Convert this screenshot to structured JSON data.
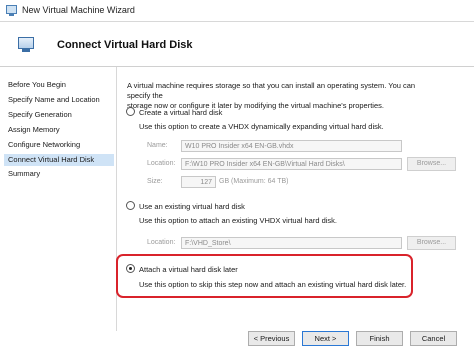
{
  "window": {
    "title": "New Virtual Machine Wizard"
  },
  "header": {
    "title": "Connect Virtual Hard Disk",
    "icon": "virtual-machine-icon"
  },
  "sidebar": {
    "items": [
      {
        "label": "Before You Begin",
        "active": false
      },
      {
        "label": "Specify Name and Location",
        "active": false
      },
      {
        "label": "Specify Generation",
        "active": false
      },
      {
        "label": "Assign Memory",
        "active": false
      },
      {
        "label": "Configure Networking",
        "active": false
      },
      {
        "label": "Connect Virtual Hard Disk",
        "active": true
      },
      {
        "label": "Summary",
        "active": false
      }
    ]
  },
  "main": {
    "intro_line1": "A virtual machine requires storage so that you can install an operating system. You can specify the",
    "intro_line2": "storage now or configure it later by modifying the virtual machine's properties.",
    "create": {
      "label": "Create a virtual hard disk",
      "description": "Use this option to create a VHDX dynamically expanding virtual hard disk.",
      "name_label": "Name:",
      "name_value": "W10 PRO Insider x64 EN-GB.vhdx",
      "location_label": "Location:",
      "location_value": "F:\\W10 PRO Insider x64 EN-GB\\Virtual Hard Disks\\",
      "browse_label": "Browse...",
      "size_label": "Size:",
      "size_value": "127",
      "size_unit": "GB (Maximum: 64 TB)"
    },
    "existing": {
      "label": "Use an existing virtual hard disk",
      "description": "Use this option to attach an existing VHDX virtual hard disk.",
      "location_label": "Location:",
      "location_value": "F:\\VHD_Store\\",
      "browse_label": "Browse..."
    },
    "later": {
      "label": "Attach a virtual hard disk later",
      "description": "Use this option to skip this step now and attach an existing virtual hard disk later.",
      "selected": true
    }
  },
  "footer": {
    "previous": "< Previous",
    "next": "Next >",
    "finish": "Finish",
    "cancel": "Cancel"
  },
  "colors": {
    "highlight": "#d9232b",
    "selection": "#cfe3f6",
    "accent": "#2b78d4"
  }
}
